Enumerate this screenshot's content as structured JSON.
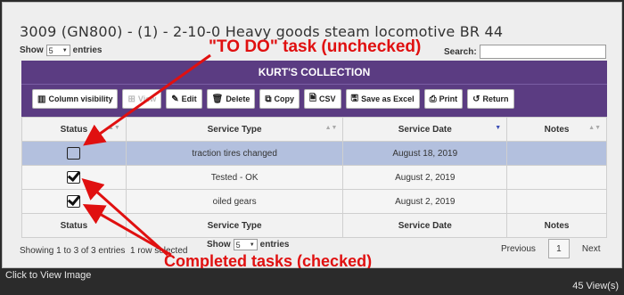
{
  "page": {
    "title": "3009 (GN800) - (1) - 2-10-0 Heavy goods steam locomotive BR 44",
    "show_label": "Show",
    "entries_label": "entries",
    "entries_value": "5",
    "search_label": "Search:"
  },
  "panel": {
    "heading": "KURT'S COLLECTION",
    "buttons": [
      {
        "label": "Column visibility",
        "icon": "columns-icon"
      },
      {
        "label": "View",
        "icon": "plus-icon"
      },
      {
        "label": "Edit",
        "icon": "pencil-icon"
      },
      {
        "label": "Delete",
        "icon": "trash-icon"
      },
      {
        "label": "Copy",
        "icon": "copy-icon"
      },
      {
        "label": "CSV",
        "icon": "file-icon"
      },
      {
        "label": "Save as Excel",
        "icon": "save-icon"
      },
      {
        "label": "Print",
        "icon": "print-icon"
      },
      {
        "label": "Return",
        "icon": "undo-icon"
      }
    ]
  },
  "table": {
    "headers": [
      "Status",
      "Service Type",
      "Service Date",
      "Notes"
    ],
    "rows": [
      {
        "status": "unchecked",
        "service_type": "traction tires changed",
        "service_date": "August 18, 2019",
        "notes": ""
      },
      {
        "status": "checked",
        "service_type": "Tested - OK",
        "service_date": "August 2, 2019",
        "notes": ""
      },
      {
        "status": "checked",
        "service_type": "oiled gears",
        "service_date": "August 2, 2019",
        "notes": ""
      }
    ]
  },
  "footer": {
    "info": "Showing 1 to 3 of 3 entries",
    "row_selected": "1 row selected",
    "previous": "Previous",
    "current_page": "1",
    "next": "Next"
  },
  "annotations": {
    "todo": "\"TO DO\" task (unchecked)",
    "completed": "Completed tasks (checked)"
  },
  "bottom_bar": {
    "left": "Click to View Image",
    "right": "45 View(s)"
  },
  "colors": {
    "panel": "#5b3c82",
    "highlight_row": "#b3c0de",
    "annotation": "#e01010"
  }
}
